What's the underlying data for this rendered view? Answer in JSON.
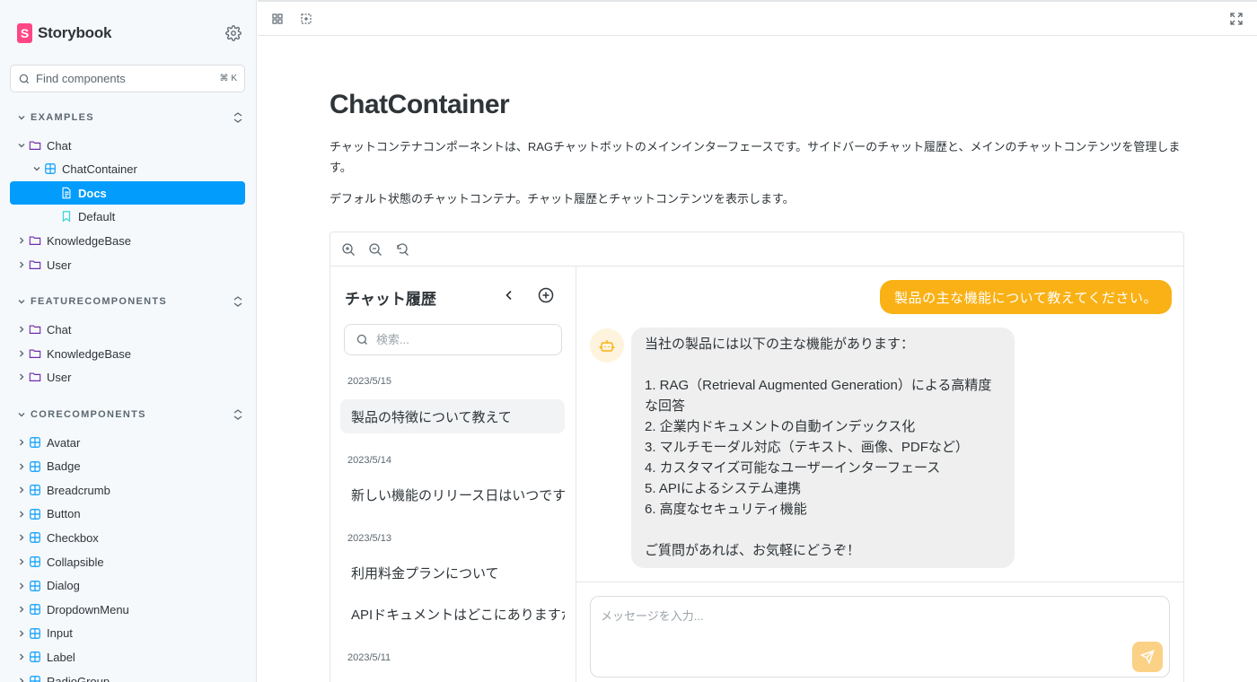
{
  "app": {
    "name": "Storybook",
    "logo_letter": "S",
    "brand_color": "#ff4785",
    "accent": "#029cfd"
  },
  "search": {
    "placeholder": "Find components",
    "shortcut": "⌘ K"
  },
  "sections": [
    {
      "label": "EXAMPLES"
    },
    {
      "label": "FEATURECOMPONENTS"
    },
    {
      "label": "CORECOMPONENTS"
    }
  ],
  "tree": {
    "examples": {
      "chat": "Chat",
      "chat_container": "ChatContainer",
      "docs": "Docs",
      "default": "Default",
      "knowledge_base": "KnowledgeBase",
      "user": "User"
    },
    "feature": {
      "chat": "Chat",
      "knowledge_base": "KnowledgeBase",
      "user": "User"
    },
    "core": [
      "Avatar",
      "Badge",
      "Breadcrumb",
      "Button",
      "Checkbox",
      "Collapsible",
      "Dialog",
      "DropdownMenu",
      "Input",
      "Label",
      "RadioGroup"
    ]
  },
  "doc": {
    "title": "ChatContainer",
    "description": "チャットコンテナコンポーネントは、RAGチャットボットのメインインターフェースです。サイドバーのチャット履歴と、メインのチャットコンテンツを管理します。",
    "story_description": "デフォルト状態のチャットコンテナ。チャット履歴とチャットコンテンツを表示します。"
  },
  "history": {
    "title": "チャット履歴",
    "search_placeholder": "検索...",
    "groups": [
      {
        "date": "2023/5/15",
        "items": [
          "製品の特徴について教えて"
        ]
      },
      {
        "date": "2023/5/14",
        "items": [
          "新しい機能のリリース日はいつですか"
        ]
      },
      {
        "date": "2023/5/13",
        "items": [
          "利用料金プランについて",
          "APIドキュメントはどこにありますか"
        ]
      },
      {
        "date": "2023/5/11",
        "items": []
      }
    ]
  },
  "chat": {
    "user_message": "製品の主な機能について教えてください。",
    "bot_lines": [
      "当社の製品には以下の主な機能があります：",
      "",
      "1. RAG（Retrieval Augmented Generation）による高精度",
      "な回答",
      "2. 企業内ドキュメントの自動インデックス化",
      "3. マルチモーダル対応（テキスト、画像、PDFなど）",
      "4. カスタマイズ可能なユーザーインターフェース",
      "5. APIによるシステム連携",
      "6. 高度なセキュリティ機能",
      "",
      "ご質問があれば、お気軽にどうぞ！"
    ],
    "input_placeholder": "メッセージを入力..."
  },
  "colors": {
    "user_bubble": "#f9b115",
    "bot_bubble": "#efefef",
    "send_button": "#fbd186"
  }
}
